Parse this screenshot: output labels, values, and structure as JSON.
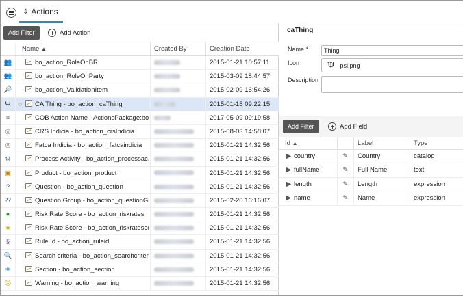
{
  "tab": {
    "icon": "sort-arrows-icon",
    "label": "Actions"
  },
  "left": {
    "add_filter": "Add Filter",
    "add_action": "Add Action",
    "columns": {
      "name": "Name",
      "created_by": "Created By",
      "creation_date": "Creation Date"
    },
    "rows": [
      {
        "icon": "users-icon",
        "glyph": "👥",
        "name": "bo_action_RoleOnBR",
        "by": "luparia",
        "date": "2015-01-21 10:57:11"
      },
      {
        "icon": "users-icon",
        "glyph": "👥",
        "name": "bo_action_RoleOnParty",
        "by": "luparia",
        "date": "2015-03-09 18:44:57"
      },
      {
        "icon": "magnifier-icon",
        "glyph": "🔎",
        "name": "bo_action_ValidationItem",
        "by": "luparia",
        "date": "2015-02-09 16:54:26"
      },
      {
        "icon": "psi-icon",
        "glyph": "Ψ",
        "name": "CA Thing - bo_action_caThing",
        "by": "suter",
        "date": "2015-01-15 09:22:15",
        "selected": true
      },
      {
        "icon": "lines-icon",
        "glyph": "≡",
        "name": "COB Action Name - ActionsPackage:bo...",
        "by": "fdd",
        "date": "2017-05-09 09:19:58"
      },
      {
        "icon": "fingerprint-icon",
        "glyph": "◎",
        "name": "CRS Indicia - bo_action_crsIndicia",
        "by": "hverdokhlebov",
        "date": "2015-08-03 14:58:07"
      },
      {
        "icon": "fingerprint-icon",
        "glyph": "◎",
        "name": "Fatca Indicia - bo_action_fatcaindicia",
        "by": "hverdokhlebov",
        "date": "2015-01-21 14:32:56"
      },
      {
        "icon": "gears-icon",
        "glyph": "⚙",
        "name": "Process Activity - bo_action_processac...",
        "by": "hverdokhlebov",
        "date": "2015-01-21 14:32:56"
      },
      {
        "icon": "product-icon",
        "glyph": "▣",
        "name": "Product - bo_action_product",
        "by": "hverdokhlebov",
        "date": "2015-01-21 14:32:56"
      },
      {
        "icon": "question-icon",
        "glyph": "?",
        "name": "Question - bo_action_question",
        "by": "hverdokhlebov",
        "date": "2015-01-21 14:32:56"
      },
      {
        "icon": "question-group-icon",
        "glyph": "⁇",
        "name": "Question Group - bo_action_questionGr...",
        "by": "hverdokhlebov",
        "date": "2015-02-20 16:16:07"
      },
      {
        "icon": "traffic-light-icon",
        "glyph": "●",
        "name": "Risk Rate Score - bo_action_riskrates",
        "by": "hverdokhlebov",
        "date": "2015-01-21 14:32:56"
      },
      {
        "icon": "star-icon",
        "glyph": "★",
        "name": "Risk Rate Score - bo_action_riskratesco...",
        "by": "hverdokhlebov",
        "date": "2015-01-21 14:32:56"
      },
      {
        "icon": "rule-icon",
        "glyph": "§",
        "name": "Rule Id - bo_action_ruleid",
        "by": "hverdokhlebov",
        "date": "2015-01-21 14:32:56"
      },
      {
        "icon": "search-icon",
        "glyph": "🔍",
        "name": "Search criteria - bo_action_searchcriteri...",
        "by": "hverdokhlebov",
        "date": "2015-01-21 14:32:56"
      },
      {
        "icon": "puzzle-icon",
        "glyph": "✚",
        "name": "Section - bo_action_section",
        "by": "hverdokhlebov",
        "date": "2015-01-21 14:32:56"
      },
      {
        "icon": "warning-face-icon",
        "glyph": "☹",
        "name": "Warning - bo_action_warning",
        "by": "hverdokhlebov",
        "date": "2015-01-21 14:32:56"
      }
    ]
  },
  "right": {
    "title": "caThing",
    "name_label": "Name *",
    "name_value": "Thing",
    "icon_label": "Icon",
    "icon_value": "psi.png",
    "description_label": "Description",
    "add_filter": "Add Filter",
    "add_field": "Add Field",
    "columns": {
      "id": "Id",
      "label": "Label",
      "type": "Type"
    },
    "fields": [
      {
        "id": "country",
        "label": "Country",
        "type": "catalog"
      },
      {
        "id": "fullName",
        "label": "Full Name",
        "type": "text"
      },
      {
        "id": "length",
        "label": "Length",
        "type": "expression"
      },
      {
        "id": "name",
        "label": "Name",
        "type": "expression"
      }
    ]
  },
  "colors": {
    "accent": "#2a86cf",
    "selected_row": "#dbe7f6",
    "dark_button": "#555555"
  }
}
